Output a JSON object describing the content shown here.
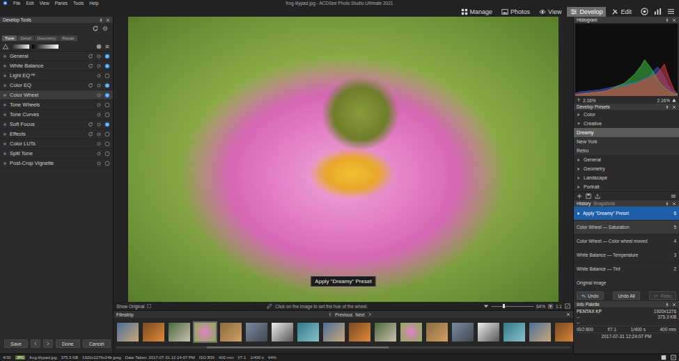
{
  "window": {
    "title": "frog-lilypad.jpg - ACDSee Photo Studio Ultimate 2021"
  },
  "menu": [
    "File",
    "Edit",
    "View",
    "Panes",
    "Tools",
    "Help"
  ],
  "modes": [
    {
      "label": "Manage",
      "selected": false
    },
    {
      "label": "Photos",
      "selected": false
    },
    {
      "label": "View",
      "selected": false
    },
    {
      "label": "Develop",
      "selected": true
    },
    {
      "label": "Edit",
      "selected": false
    }
  ],
  "develop_tools": {
    "title": "Develop Tools",
    "tabs": [
      {
        "label": "Tune",
        "selected": true
      },
      {
        "label": "Detail",
        "selected": false
      },
      {
        "label": "Geometry",
        "selected": false
      },
      {
        "label": "Repair",
        "selected": false
      }
    ],
    "groups": [
      {
        "label": "General",
        "has_reset": true,
        "enabled": true,
        "selected": false
      },
      {
        "label": "White Balance",
        "has_reset": true,
        "enabled": true,
        "selected": false
      },
      {
        "label": "Light EQ™",
        "has_reset": false,
        "enabled": false,
        "selected": false
      },
      {
        "label": "Color EQ",
        "has_reset": true,
        "enabled": true,
        "selected": false
      },
      {
        "label": "Color Wheel",
        "has_reset": false,
        "enabled": true,
        "selected": true
      },
      {
        "label": "Tone Wheels",
        "has_reset": false,
        "enabled": false,
        "selected": false
      },
      {
        "label": "Tone Curves",
        "has_reset": false,
        "enabled": false,
        "selected": false
      },
      {
        "label": "Soft Focus",
        "has_reset": true,
        "enabled": true,
        "selected": false
      },
      {
        "label": "Effects",
        "has_reset": true,
        "enabled": false,
        "selected": false
      },
      {
        "label": "Color LUTs",
        "has_reset": false,
        "enabled": false,
        "selected": false
      },
      {
        "label": "Split Tone",
        "has_reset": false,
        "enabled": false,
        "selected": false
      },
      {
        "label": "Post-Crop Vignette",
        "has_reset": false,
        "enabled": false,
        "selected": false
      }
    ],
    "buttons": {
      "save": "Save",
      "done": "Done",
      "cancel": "Cancel"
    }
  },
  "viewer": {
    "tooltip": "Apply \"Dreamy\" Preset",
    "show_original": "Show Original",
    "hint": "Click on the image to set the hue of the wheel.",
    "zoom": "64%",
    "zoom_level": 0.3,
    "ratio": "1:1"
  },
  "filmstrip": {
    "title": "Filmstrip",
    "previous": "Previous",
    "next": "Next",
    "thumbnails": [
      {
        "selected": false
      },
      {
        "selected": false
      },
      {
        "selected": false
      },
      {
        "selected": true
      },
      {
        "selected": false
      },
      {
        "selected": false
      },
      {
        "selected": false
      },
      {
        "selected": false
      },
      {
        "selected": false
      },
      {
        "selected": false
      },
      {
        "selected": false
      },
      {
        "selected": false
      },
      {
        "selected": false
      },
      {
        "selected": false
      },
      {
        "selected": false
      },
      {
        "selected": false
      },
      {
        "selected": false
      },
      {
        "selected": false
      },
      {
        "selected": false
      }
    ]
  },
  "histogram": {
    "title": "Histogram",
    "series": [
      {
        "name": "blue",
        "color": "#3b5bd9",
        "values": [
          4,
          5,
          6,
          6,
          7,
          7,
          8,
          8,
          9,
          10,
          11,
          12,
          13,
          14,
          15,
          16,
          17,
          18,
          19,
          20,
          22,
          24,
          26,
          30,
          36,
          40,
          34,
          26,
          16,
          10,
          6,
          3
        ]
      },
      {
        "name": "green",
        "color": "#3fbf3f",
        "values": [
          2,
          2,
          3,
          3,
          4,
          4,
          5,
          5,
          6,
          7,
          8,
          10,
          12,
          14,
          16,
          18,
          22,
          26,
          30,
          36,
          42,
          50,
          44,
          38,
          30,
          22,
          16,
          12,
          8,
          5,
          3,
          2
        ]
      },
      {
        "name": "red",
        "color": "#e03a3a",
        "values": [
          2,
          3,
          3,
          4,
          4,
          5,
          5,
          6,
          6,
          7,
          8,
          9,
          10,
          11,
          12,
          13,
          14,
          15,
          16,
          18,
          20,
          22,
          24,
          26,
          28,
          32,
          38,
          44,
          30,
          18,
          8,
          3
        ]
      }
    ],
    "readings": {
      "shadows": "2.16%",
      "highlights": "2.16%"
    }
  },
  "presets": {
    "title": "Develop Presets",
    "items": [
      {
        "label": "Color",
        "kind": "folder",
        "expanded": false,
        "selected": false
      },
      {
        "label": "Creative",
        "kind": "folder",
        "expanded": true,
        "selected": false
      },
      {
        "label": "Dreamy",
        "kind": "preset",
        "expanded": false,
        "selected": true
      },
      {
        "label": "New York",
        "kind": "preset",
        "expanded": false,
        "selected": false
      },
      {
        "label": "Retro",
        "kind": "preset",
        "expanded": false,
        "selected": false
      },
      {
        "label": "General",
        "kind": "folder",
        "expanded": false,
        "selected": false
      },
      {
        "label": "Geometry",
        "kind": "folder",
        "expanded": false,
        "selected": false
      },
      {
        "label": "Landscape",
        "kind": "folder",
        "expanded": false,
        "selected": false
      },
      {
        "label": "Portrait",
        "kind": "folder",
        "expanded": false,
        "selected": false
      }
    ]
  },
  "history": {
    "tabs": [
      {
        "label": "History",
        "selected": true
      },
      {
        "label": "Snapshots",
        "selected": false
      }
    ],
    "items": [
      {
        "label": "Apply \"Dreamy\" Preset",
        "step": "6",
        "selected": true,
        "hovered": false
      },
      {
        "label": "Color Wheel — Saturation",
        "step": "5",
        "selected": false,
        "hovered": true
      },
      {
        "label": "Color Wheel — Color wheel moved",
        "step": "4",
        "selected": false,
        "hovered": false
      },
      {
        "label": "White Balance — Temperature",
        "step": "3",
        "selected": false,
        "hovered": false
      },
      {
        "label": "White Balance — Tint",
        "step": "2",
        "selected": false,
        "hovered": false
      },
      {
        "label": "Original Image",
        "step": "",
        "selected": false,
        "hovered": false
      }
    ],
    "buttons": [
      {
        "label": "Undo",
        "disabled": false
      },
      {
        "label": "Undo All",
        "disabled": false
      },
      {
        "label": "Redo",
        "disabled": true
      }
    ]
  },
  "info": {
    "title": "Info Palette",
    "camera": "PENTAX KP",
    "dimensions": "1920x1276",
    "blank1": "--",
    "size": "375.3 KB",
    "blank2": "--",
    "exposure": [
      "ISO 800",
      "f/7.1",
      "1/400 s",
      "400 mm"
    ],
    "date": "2017-07-31 12:24:07 PM"
  },
  "status_bar": {
    "position": "4/30",
    "type": "JPG",
    "file": "frog-lilypad.jpg",
    "size": "375.3 KB",
    "format": "1920x1276x24b jpeg",
    "date": "Date Taken: 2017-07-31 12:24:07 PM",
    "iso": "ISO 800",
    "focal": "400 mm",
    "aperture": "f/7.1",
    "shutter": "1/400 s",
    "zoom": "64%"
  }
}
